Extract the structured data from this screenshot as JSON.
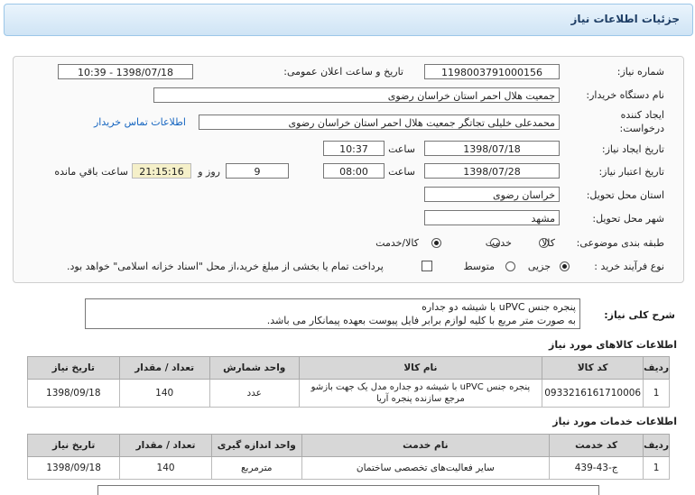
{
  "header": {
    "title": "جزئیات اطلاعات نیاز"
  },
  "form": {
    "need_number_label": "شماره نیاز:",
    "need_number": "1198003791000156",
    "announce_label": "تاریخ و ساعت اعلان عمومی:",
    "announce_value": "1398/07/18 - 10:39",
    "buyer_label": "نام دستگاه خریدار:",
    "buyer_value": "جمعیت هلال احمر استان خراسان رضوی",
    "creator_label_1": "ایجاد کننده",
    "creator_label_2": "درخواست:",
    "creator_value": "محمدعلی خلیلی تجاتگر جمعیت هلال احمر استان خراسان رضوی",
    "contact_link": "اطلاعات تماس خریدار",
    "create_date_label": "تاریخ ایجاد نیاز:",
    "create_date": "1398/07/18",
    "time_label": "ساعت",
    "create_time": "10:37",
    "valid_date_label": "تاریخ اعتبار نیاز:",
    "valid_date": "1398/07/28",
    "valid_time": "08:00",
    "days": "9",
    "days_label": "روز و",
    "remaining": "21:15:16",
    "remaining_label": "ساعت باقي مانده",
    "province_label": "استان محل تحویل:",
    "province": "خراسان رضوی",
    "city_label": "شهر محل تحویل:",
    "city": "مشهد",
    "category_label": "طبقه بندی موضوعی:",
    "cat_goods": "کالا",
    "cat_service": "خدمت",
    "cat_both": "کالا/خدمت",
    "process_label": "نوع فرآیند خرید :",
    "proc_partial": "جزیی",
    "proc_medium": "متوسط",
    "payment_note": "پرداخت تمام یا بخشی از مبلغ خرید،از محل \"اسناد خزانه اسلامی\" خواهد بود."
  },
  "description": {
    "label": "شرح کلی نیاز:",
    "line1": "پنجره جنس uPVC با شیشه دو جداره",
    "line2": "به صورت متر مربع با کلیه لوازم برابر فایل پیوست بعهده پیمانکار می باشد."
  },
  "goods": {
    "title": "اطلاعات کالاهای مورد نیاز",
    "headers": [
      "ردیف",
      "کد کالا",
      "نام کالا",
      "واحد شمارش",
      "تعداد / مقدار",
      "تاریخ نیاز"
    ],
    "row": [
      "1",
      "0933216161710006",
      "پنجره جنس uPVC با شیشه دو جداره مدل یک جهت بازشو مرجع سازنده پنجره آریا",
      "عدد",
      "140",
      "1398/09/18"
    ]
  },
  "services": {
    "title": "اطلاعات خدمات مورد نیاز",
    "headers": [
      "ردیف",
      "کد خدمت",
      "نام خدمت",
      "واحد اندازه گیری",
      "تعداد / مقدار",
      "تاریخ نیاز"
    ],
    "row": [
      "1",
      "ج-43-439",
      "سایر فعالیت‌های تخصصی ساختمان",
      "مترمربع",
      "140",
      "1398/09/18"
    ]
  }
}
